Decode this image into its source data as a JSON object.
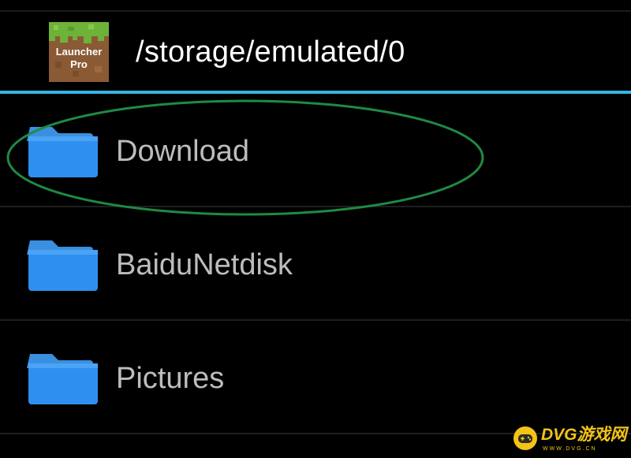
{
  "header": {
    "app_icon_label_line1": "Launcher",
    "app_icon_label_line2": "Pro",
    "path": "/storage/emulated/0"
  },
  "folders": [
    {
      "name": "Download",
      "icon": "folder-icon"
    },
    {
      "name": "BaiduNetdisk",
      "icon": "folder-icon"
    },
    {
      "name": "Pictures",
      "icon": "folder-icon"
    }
  ],
  "watermark": {
    "brand": "DVG游戏网",
    "url": "WWW.DVG.CN"
  },
  "colors": {
    "background": "#000000",
    "accent": "#33b5e5",
    "folder_blue": "#2f8ff0",
    "highlight_ellipse": "#1f8a44",
    "text_primary": "#ffffff",
    "text_item": "#bdbdbd",
    "watermark": "#f3c318"
  }
}
